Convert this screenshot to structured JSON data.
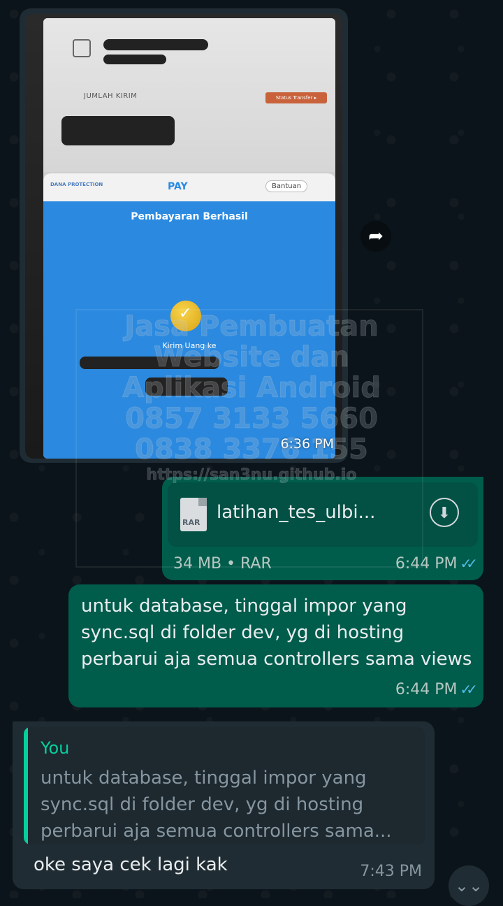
{
  "image_message": {
    "time": "6:36 PM",
    "screenshot": {
      "amount_label": "JUMLAH KIRIM",
      "status_tag": "Status Transfer ▸",
      "dana_protection": "DANA PROTECTION",
      "pay_label": "PAY",
      "help_label": "Bantuan",
      "success_title": "Pembayaran Berhasil",
      "send_to": "Kirim Uang ke"
    }
  },
  "watermark": {
    "line1": "Jasa Pembuatan",
    "line2": "Website dan",
    "line3": "Aplikasi Android",
    "line4": "0857 3133 5660",
    "line5": "0838 3376 155",
    "line6": "https://san3nu.github.io"
  },
  "file_message": {
    "icon_label": "RAR",
    "file_name": "latihan_tes_ulbi...",
    "meta": "34 MB • RAR",
    "time": "6:44 PM"
  },
  "text_message": {
    "text": "untuk database, tinggal impor yang sync.sql di folder dev, yg di hosting perbarui aja semua controllers sama views",
    "time": "6:44 PM"
  },
  "reply_message": {
    "quote_author": "You",
    "quote_text": "untuk database, tinggal impor yang sync.sql di folder dev, yg di hosting perbarui aja semua controllers sama...",
    "text": "oke saya cek lagi kak",
    "time": "7:43 PM"
  },
  "colors": {
    "background": "#0b141a",
    "outgoing_bubble": "#005c4b",
    "incoming_bubble": "#202c33",
    "read_ticks": "#53bdeb",
    "quote_accent": "#06cf9c"
  },
  "icons": {
    "forward": "forward-icon",
    "download": "download-icon",
    "scroll_down": "double-chevron-down-icon",
    "read_receipt": "double-check-icon"
  }
}
